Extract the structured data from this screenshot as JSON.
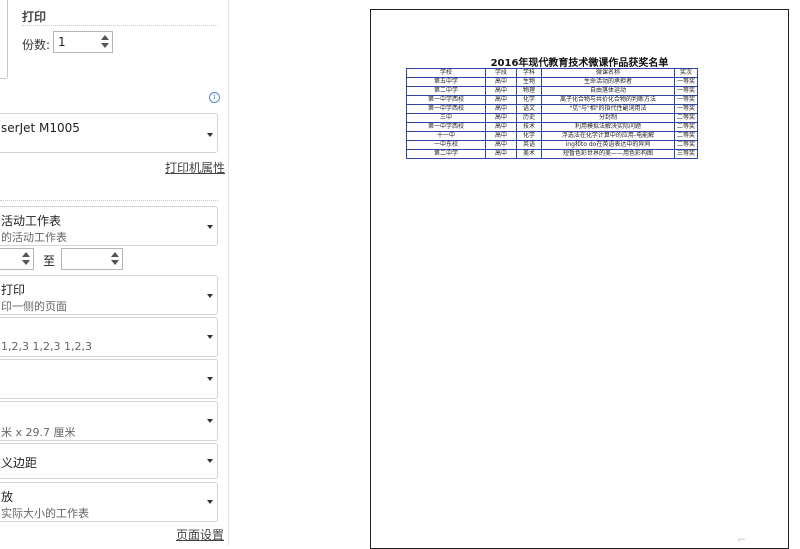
{
  "print_panel": {
    "title": "打印",
    "copies_label": "份数:",
    "copies_value": "1",
    "printer": {
      "name": "serJet M1005"
    },
    "printer_properties_link": "打印机属性",
    "what_to_print": {
      "line1": "活动工作表",
      "line2": "的活动工作表"
    },
    "pages": {
      "from_value": "",
      "to_label": "至",
      "to_value": ""
    },
    "sides": {
      "line1": "打印",
      "line2": "印一侧的页面"
    },
    "collate": {
      "line1": "",
      "line2": "1,2,3    1,2,3    1,2,3"
    },
    "orientation": {
      "line1": ""
    },
    "paper_size": {
      "line1": "",
      "line2": "米 x 29.7 厘米"
    },
    "margins": {
      "line1": "义边距"
    },
    "scaling": {
      "line1": "放",
      "line2": "实际大小的工作表"
    },
    "page_setup_link": "页面设置",
    "info_icon": "info-icon"
  },
  "preview": {
    "title": "2016年现代教育技术微课作品获奖名单",
    "table": {
      "headers": [
        "学校",
        "学段",
        "学科",
        "微课名称",
        "奖次"
      ],
      "rows": [
        [
          "第五中学",
          "高中",
          "生物",
          "生命活动的承担者",
          "一等奖"
        ],
        [
          "第二中学",
          "高中",
          "物理",
          "自由落体运动",
          "一等奖"
        ],
        [
          "第一中学西校",
          "高中",
          "化学",
          "离子化合物与共价化合物的判断方法",
          "一等奖"
        ],
        [
          "第一中学西校",
          "高中",
          "语文",
          "\"见\"与\"相\"的指代性副词用法",
          "一等奖"
        ],
        [
          "三中",
          "高中",
          "历史",
          "分封制",
          "二等奖"
        ],
        [
          "第一中学西校",
          "高中",
          "技术",
          "利用模拟法解决实际问题",
          "二等奖"
        ],
        [
          "十一中",
          "高中",
          "化学",
          "浮选法在化学计算中的应用-电能解",
          "二等奖"
        ],
        [
          "一中东校",
          "高中",
          "英语",
          "ing和to do在英语表达中的异同",
          "二等奖"
        ],
        [
          "第二中学",
          "高中",
          "美术",
          "短暂色彩世界的美——用色彩构图",
          "三等奖"
        ]
      ]
    }
  }
}
